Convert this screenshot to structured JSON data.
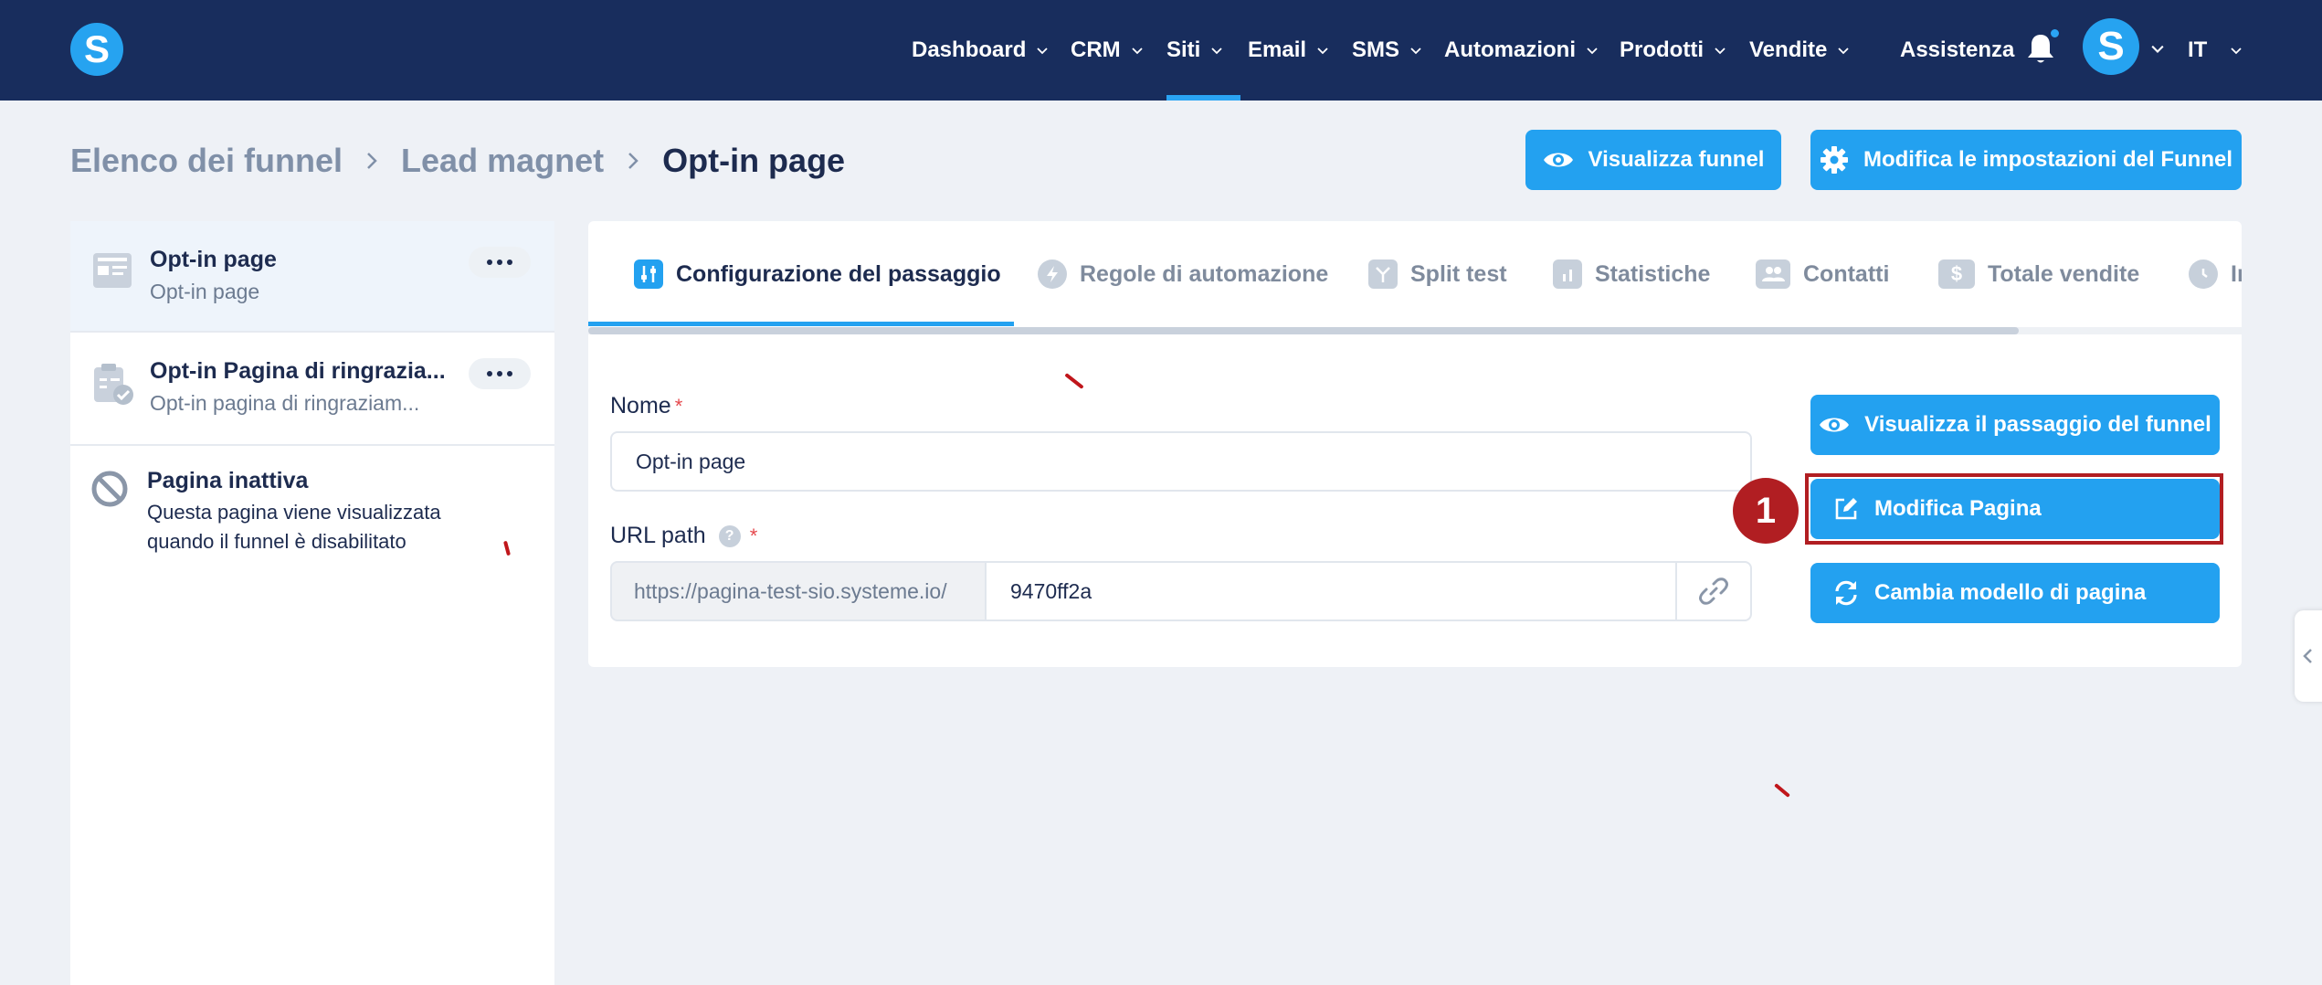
{
  "nav": {
    "items": [
      {
        "label": "Dashboard"
      },
      {
        "label": "CRM"
      },
      {
        "label": "Siti"
      },
      {
        "label": "Email"
      },
      {
        "label": "SMS"
      },
      {
        "label": "Automazioni"
      },
      {
        "label": "Prodotti"
      },
      {
        "label": "Vendite"
      }
    ],
    "help_label": "Assistenza",
    "language": "IT",
    "logo_letter": "S",
    "avatar_letter": "S",
    "active_item": "Siti"
  },
  "breadcrumb": {
    "items": [
      "Elenco dei funnel",
      "Lead magnet",
      "Opt-in page"
    ]
  },
  "header_actions": {
    "view_funnel": "Visualizza funnel",
    "edit_funnel_settings": "Modifica le impostazioni del Funnel"
  },
  "steps": [
    {
      "title": "Opt-in page",
      "subtitle": "Opt-in page"
    },
    {
      "title": "Opt-in Pagina di ringrazia...",
      "subtitle": "Opt-in pagina di ringraziam..."
    },
    {
      "title": "Pagina inattiva",
      "subtitle_line1": "Questa pagina viene visualizzata",
      "subtitle_line2": "quando il funnel è disabilitato"
    }
  ],
  "tabs": [
    {
      "label": "Configurazione del passaggio",
      "icon": "sliders-icon"
    },
    {
      "label": "Regole di automazione",
      "icon": "bolt-icon"
    },
    {
      "label": "Split test",
      "icon": "split-icon"
    },
    {
      "label": "Statistiche",
      "icon": "bar-chart-icon"
    },
    {
      "label": "Contatti",
      "icon": "users-icon"
    },
    {
      "label": "Totale vendite",
      "icon": "dollar-icon"
    },
    {
      "label": "In",
      "icon": "clock-icon"
    }
  ],
  "form": {
    "name_label": "Nome",
    "name_value": "Opt-in page",
    "url_label": "URL path",
    "url_prefix": "https://pagina-test-sio.systeme.io/",
    "url_value": "9470ff2a",
    "required_mark": "*",
    "help_mark": "?"
  },
  "step_actions": {
    "view_step": "Visualizza il passaggio del funnel",
    "edit_page": "Modifica Pagina",
    "change_template": "Cambia modello di pagina"
  },
  "annotation": {
    "number": "1"
  },
  "colors": {
    "navbar": "#182d5d",
    "accent": "#23a1f0",
    "highlight": "#b11e22"
  }
}
